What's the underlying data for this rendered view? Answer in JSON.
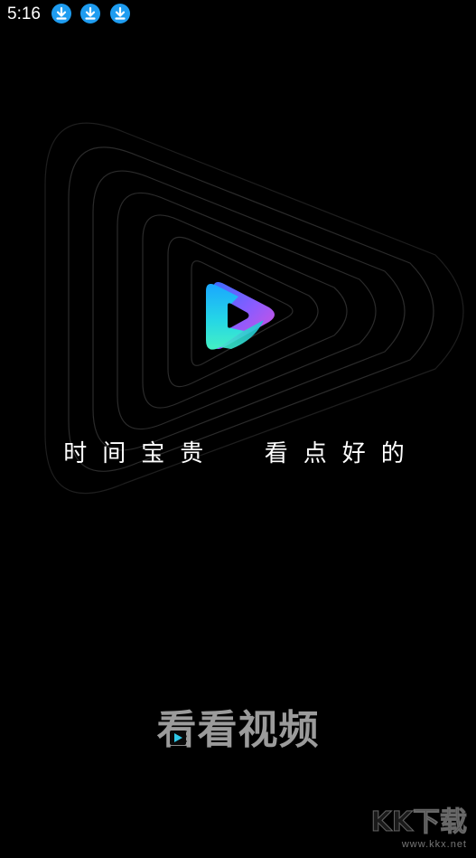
{
  "status_bar": {
    "time": "5:16",
    "icons": [
      "download-notification-icon",
      "download-notification-icon",
      "download-notification-icon"
    ],
    "icon_color": "#1e9cf0"
  },
  "splash": {
    "slogan": "时间宝贵  看点好的",
    "app_name": "看看视频",
    "logo_icon": "play-logo-icon",
    "ring_color": "#2b2b2b"
  },
  "watermark": {
    "main": "KK下载",
    "url": "www.kkx.net"
  }
}
